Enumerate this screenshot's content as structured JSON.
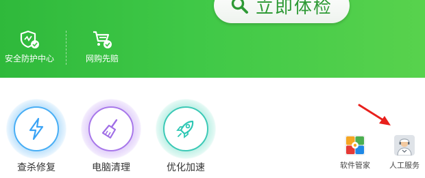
{
  "banner": {
    "check_button_label": "立即体检",
    "features": [
      {
        "label": "安全防护中心",
        "icon": "shield-check-icon"
      },
      {
        "label": "网购先赔",
        "icon": "cart-check-icon"
      }
    ]
  },
  "tools": [
    {
      "label": "查杀修复",
      "icon": "lightning-icon",
      "color": "#3aa3f5"
    },
    {
      "label": "电脑清理",
      "icon": "broom-icon",
      "color": "#a06ee6"
    },
    {
      "label": "优化加速",
      "icon": "rocket-icon",
      "color": "#2ec7b4"
    }
  ],
  "small_tools": [
    {
      "label": "软件管家",
      "icon": "software-manager-icon"
    },
    {
      "label": "人工服务",
      "icon": "support-agent-icon"
    }
  ],
  "colors": {
    "banner_green": "#3fc847",
    "button_text": "#2f9a36",
    "annotation_arrow": "#e8201c"
  }
}
